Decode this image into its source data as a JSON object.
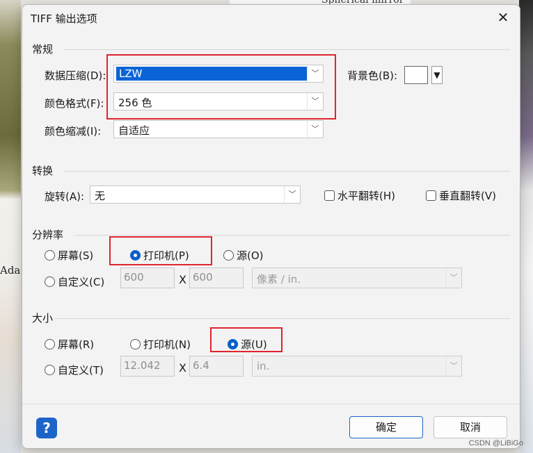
{
  "background": {
    "top_text": "Spherical mirror",
    "left_text": "Ada",
    "watermark": "CSDN @LiBiGo"
  },
  "dialog": {
    "title": "TIFF 输出选项",
    "close_icon": "close-icon"
  },
  "general": {
    "section": "常规",
    "compression_label": "数据压缩(D):",
    "compression_value": "LZW",
    "color_format_label": "颜色格式(F):",
    "color_format_value": "256 色",
    "color_reduction_label": "颜色缩减(I):",
    "color_reduction_value": "自适应",
    "background_label": "背景色(B):",
    "background_color": "#ffffff"
  },
  "transform": {
    "section": "转换",
    "rotation_label": "旋转(A):",
    "rotation_value": "无",
    "flip_h": "水平翻转(H)",
    "flip_v": "垂直翻转(V)"
  },
  "resolution": {
    "section": "分辨率",
    "screen": "屏幕(S)",
    "printer": "打印机(P)",
    "source": "源(O)",
    "custom": "自定义(C)",
    "width": "600",
    "height": "600",
    "times": "X",
    "unit": "像素 / in.",
    "selected": "printer"
  },
  "size": {
    "section": "大小",
    "screen": "屏幕(R)",
    "printer": "打印机(N)",
    "source": "源(U)",
    "custom": "自定义(T)",
    "width": "12.042",
    "height": "6.4",
    "times": "X",
    "unit": "in.",
    "selected": "source"
  },
  "footer": {
    "help": "?",
    "ok": "确定",
    "cancel": "取消"
  },
  "colors": {
    "accent": "#1d64c9",
    "highlight_box": "#e0232d"
  }
}
